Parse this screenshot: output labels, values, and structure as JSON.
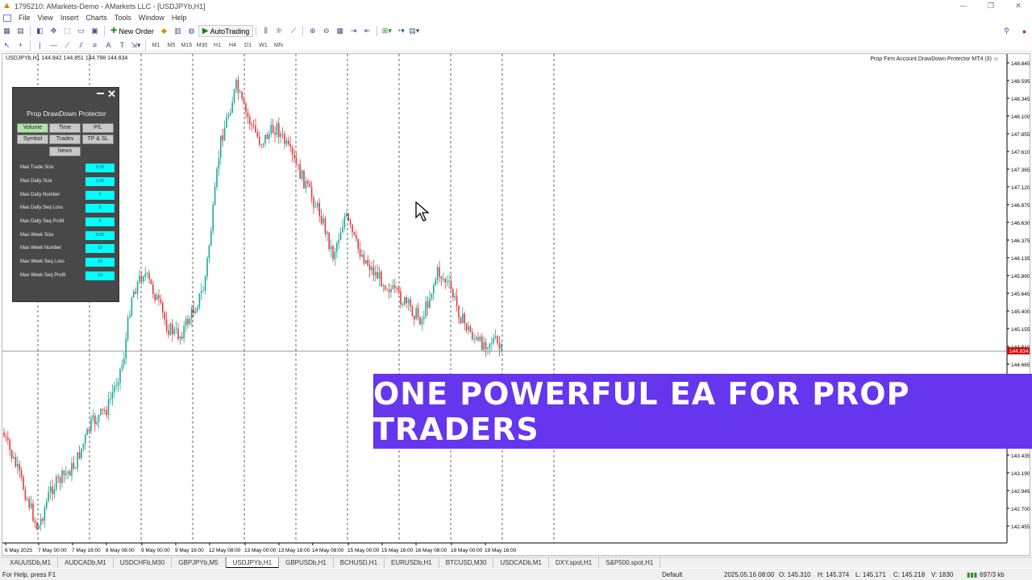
{
  "window": {
    "title": "1795210: AMarkets-Demo - AMarkets LLC - [USDJPYb,H1]",
    "controls": [
      "—",
      "❐",
      "✕"
    ]
  },
  "menu": [
    "File",
    "View",
    "Insert",
    "Charts",
    "Tools",
    "Window",
    "Help"
  ],
  "toolbar": {
    "new_order": "New Order",
    "autotrading": "AutoTrading"
  },
  "timeframes": [
    "M1",
    "M5",
    "M15",
    "M30",
    "H1",
    "H4",
    "D1",
    "W1",
    "MN"
  ],
  "chart": {
    "header": "USDJPYb,H1 144.842 144.851 144.798 144.834",
    "ea_label": "Prop Firm Account DrawDown Protector MT4 (3) ☺",
    "price_labels": [
      "148.845",
      "148.595",
      "148.345",
      "148.100",
      "147.855",
      "147.610",
      "147.365",
      "147.120",
      "146.875",
      "146.630",
      "146.375",
      "146.135",
      "145.890",
      "145.645",
      "145.400",
      "145.155",
      "144.910",
      "144.665",
      "143.435",
      "143.190",
      "142.945",
      "142.700",
      "142.455"
    ],
    "current_price": "144.834",
    "time_labels": [
      "6 May 2025",
      "7 May 00:00",
      "7 May 16:00",
      "8 May 08:00",
      "9 May 00:00",
      "9 May 16:00",
      "12 May 08:00",
      "13 May 00:00",
      "13 May 16:00",
      "14 May 08:00",
      "15 May 00:00",
      "15 May 16:00",
      "16 May 08:00",
      "19 May 00:00",
      "19 May 16:00"
    ]
  },
  "panel": {
    "title": "Prop DrawDown Protector",
    "close": "✕",
    "tabs": [
      "Volume",
      "Time",
      "P/L",
      "Symbol",
      "Trades",
      "TP & SL",
      "News"
    ],
    "rows": [
      {
        "label": "Max Trade Size",
        "value": "0.10"
      },
      {
        "label": "Max Daily Size",
        "value": "1.00"
      },
      {
        "label": "Max Daily Number",
        "value": "5"
      },
      {
        "label": "Max Daily Seq Loss",
        "value": "5"
      },
      {
        "label": "Max Daily Seq Profit",
        "value": "5"
      },
      {
        "label": "Max Week Size",
        "value": "3.00"
      },
      {
        "label": "Max Week Number",
        "value": "10"
      },
      {
        "label": "Max Week Seq Loss",
        "value": "10"
      },
      {
        "label": "Max Week Seq Profit",
        "value": "10"
      }
    ]
  },
  "banner": {
    "text": "ONE POWERFUL EA FOR PROP TRADERS"
  },
  "symbol_tabs": [
    "XAUUSDb,M1",
    "AUDCADb,M1",
    "USDCHFb,M30",
    "GBPJPYb,M5",
    "USDJPYb,H1",
    "GBPUSDb,H1",
    "BCHUSD,H1",
    "EURUSDb,H1",
    "BTCUSD,M30",
    "USDCADb,M1",
    "DXY.spot,H1",
    "S&P500.spot,H1"
  ],
  "active_symbol_tab": "USDJPYb,H1",
  "status": {
    "help": "For Help, press F1",
    "profile": "Default",
    "time": "2025.05.16 08:00",
    "open": "O: 145.310",
    "high": "H: 145.374",
    "low": "L: 145.171",
    "close": "C: 145.218",
    "volume": "V: 1830",
    "traffic": "697/3 kb"
  },
  "colors": {
    "bull": "#1aa89a",
    "bear": "#e03a3a",
    "banner": "#6635ee",
    "input": "#00ffff"
  }
}
